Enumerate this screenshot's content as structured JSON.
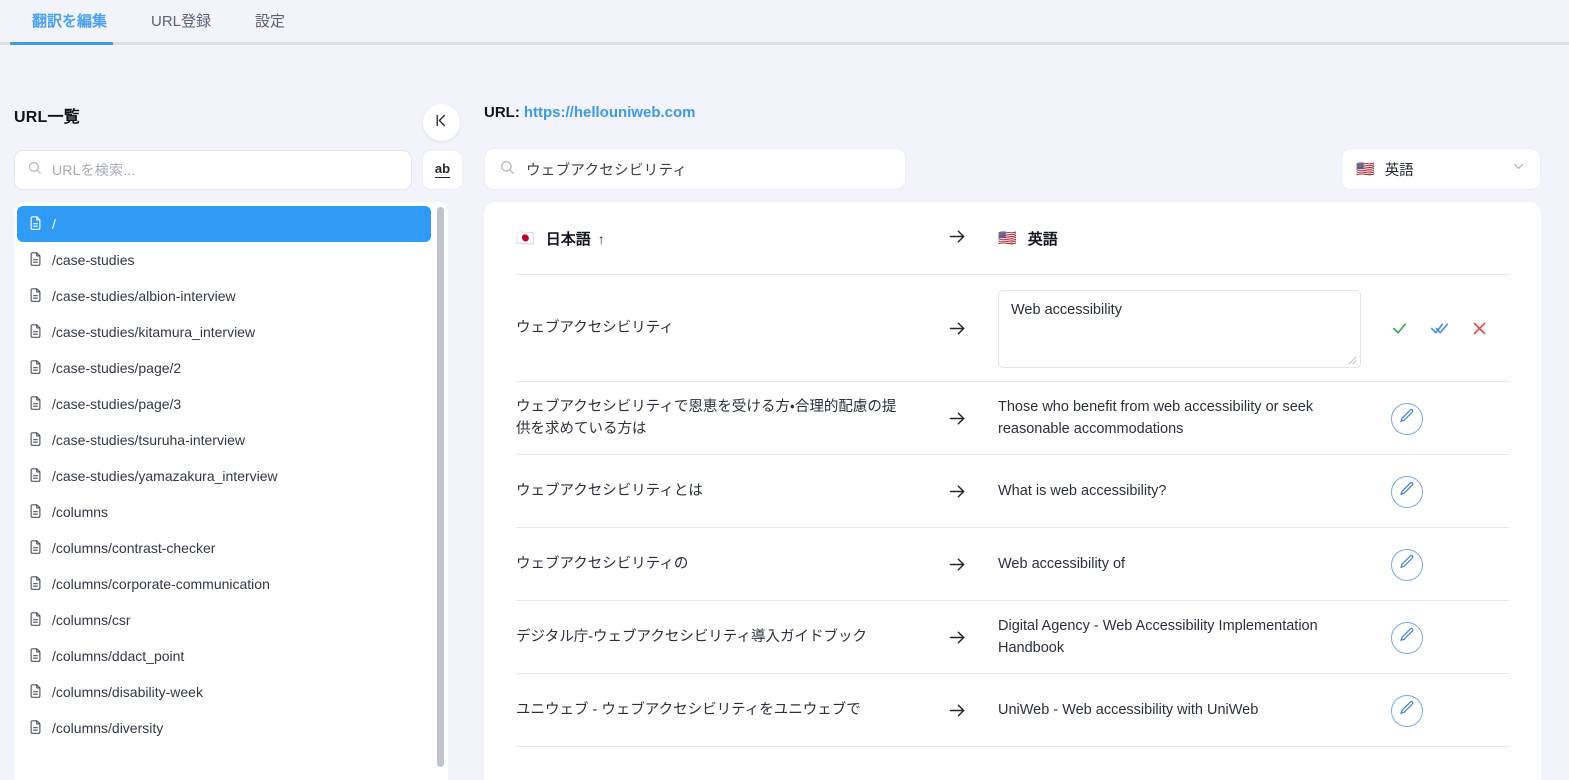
{
  "tabs": [
    {
      "label": "翻訳を編集",
      "active": true
    },
    {
      "label": "URL登録",
      "active": false
    },
    {
      "label": "設定",
      "active": false
    }
  ],
  "sidebar": {
    "title": "URL一覧",
    "search_placeholder": "URLを検索...",
    "ab_button_label": "ab",
    "collapse_icon": "collapse-panel-icon",
    "items": [
      {
        "path": "/",
        "selected": true
      },
      {
        "path": "/case-studies",
        "selected": false
      },
      {
        "path": "/case-studies/albion-interview",
        "selected": false
      },
      {
        "path": "/case-studies/kitamura_interview",
        "selected": false
      },
      {
        "path": "/case-studies/page/2",
        "selected": false
      },
      {
        "path": "/case-studies/page/3",
        "selected": false
      },
      {
        "path": "/case-studies/tsuruha-interview",
        "selected": false
      },
      {
        "path": "/case-studies/yamazakura_interview",
        "selected": false
      },
      {
        "path": "/columns",
        "selected": false
      },
      {
        "path": "/columns/contrast-checker",
        "selected": false
      },
      {
        "path": "/columns/corporate-communication",
        "selected": false
      },
      {
        "path": "/columns/csr",
        "selected": false
      },
      {
        "path": "/columns/ddact_point",
        "selected": false
      },
      {
        "path": "/columns/disability-week",
        "selected": false
      },
      {
        "path": "/columns/diversity",
        "selected": false
      }
    ]
  },
  "main": {
    "url_label": "URL:",
    "url_value": "https://hellouniweb.com",
    "search_value": "ウェブアクセシビリティ",
    "search_placeholder": "",
    "language_selector": {
      "flag": "🇺🇸",
      "label": "英語"
    },
    "table": {
      "source_column": {
        "flag": "🇯🇵",
        "label": "日本語",
        "sort": "↑"
      },
      "target_column": {
        "flag": "🇺🇸",
        "label": "英語"
      },
      "rows": [
        {
          "source": "ウェブアクセシビリティ",
          "target": "Web accessibility",
          "editing": true
        },
        {
          "source": "ウェブアクセシビリティで恩恵を受ける方・合理的配慮の提供を求めている方は",
          "target": "Those who benefit from web accessibility or seek reasonable accommodations",
          "editing": false
        },
        {
          "source": "ウェブアクセシビリティとは",
          "target": "What is web accessibility?",
          "editing": false
        },
        {
          "source": "ウェブアクセシビリティの",
          "target": "Web accessibility of",
          "editing": false
        },
        {
          "source": "デジタル庁-ウェブアクセシビリティ導入ガイドブック",
          "target": "Digital Agency - Web Accessibility Implementation Handbook",
          "editing": false
        },
        {
          "source": "ユニウェブ - ウェブアクセシビリティをユニウェブで",
          "target": "UniWeb - Web accessibility with UniWeb",
          "editing": false
        }
      ]
    }
  },
  "colors": {
    "page_background": "#f3f4fb",
    "accent_blue": "#3d9ae8",
    "selected_row": "#2f9bf5",
    "confirm_green": "#34a853",
    "confirm_all_blue": "#4a90e2",
    "cancel_red": "#e8453c",
    "edit_border": "#7aa9e8"
  }
}
